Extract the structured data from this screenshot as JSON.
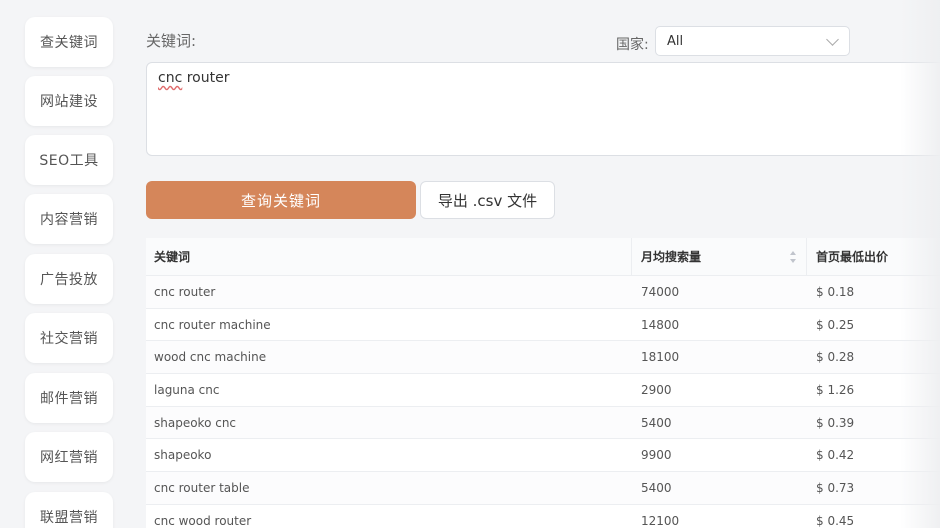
{
  "sidebar": {
    "items": [
      {
        "label": "查关键词"
      },
      {
        "label": "网站建设"
      },
      {
        "label": "SEO工具"
      },
      {
        "label": "内容营销"
      },
      {
        "label": "广告投放"
      },
      {
        "label": "社交营销"
      },
      {
        "label": "邮件营销"
      },
      {
        "label": "网红营销"
      },
      {
        "label": "联盟营销"
      }
    ]
  },
  "form": {
    "keyword_label": "关键词:",
    "country_label": "国家:",
    "country_value": "All",
    "query_word1": "cnc",
    "query_word2": " router",
    "query_button": "查询关键词",
    "export_button": "导出 .csv 文件"
  },
  "table": {
    "headers": {
      "keyword": "关键词",
      "volume": "月均搜索量",
      "bid": "首页最低出价"
    },
    "rows": [
      {
        "keyword": "cnc router",
        "volume": "74000",
        "bid": "$ 0.18"
      },
      {
        "keyword": "cnc router machine",
        "volume": "14800",
        "bid": "$ 0.25"
      },
      {
        "keyword": "wood cnc machine",
        "volume": "18100",
        "bid": "$ 0.28"
      },
      {
        "keyword": "laguna cnc",
        "volume": "2900",
        "bid": "$ 1.26"
      },
      {
        "keyword": "shapeoko cnc",
        "volume": "5400",
        "bid": "$ 0.39"
      },
      {
        "keyword": "shapeoko",
        "volume": "9900",
        "bid": "$ 0.42"
      },
      {
        "keyword": "cnc router table",
        "volume": "5400",
        "bid": "$ 0.73"
      },
      {
        "keyword": "cnc wood router",
        "volume": "12100",
        "bid": "$ 0.45"
      }
    ]
  },
  "colors": {
    "accent": "#d5865a",
    "background": "#f4f5f7"
  }
}
